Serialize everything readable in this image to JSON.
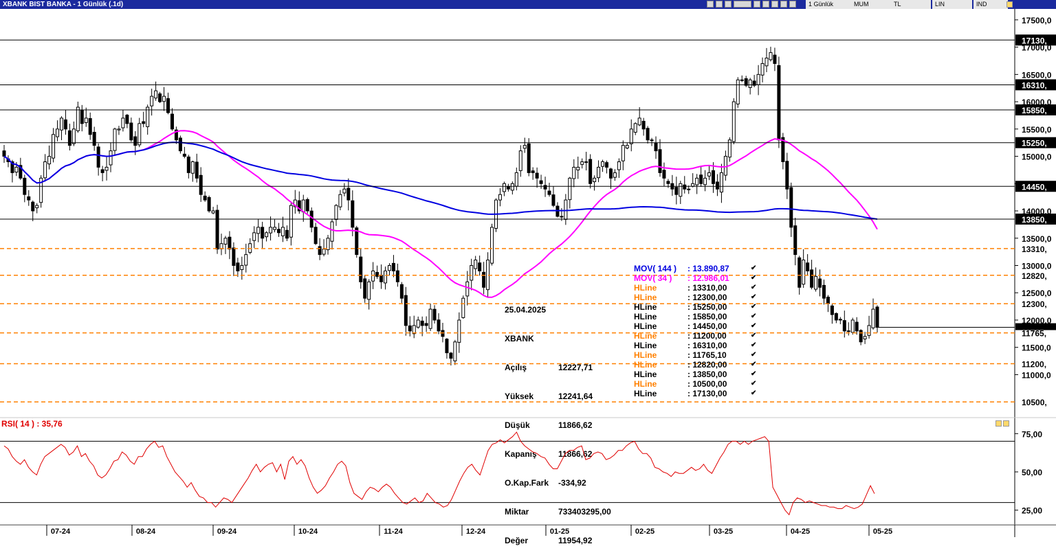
{
  "window": {
    "title": "XBANK BIST BANKA - 1 Günlük (.1d)",
    "toolbar": [
      "1 Günlük",
      "MUM",
      "TL",
      "LIN",
      "IND"
    ]
  },
  "colors": {
    "mov144": "#0000e0",
    "mov34": "#ff00ff",
    "hline_black": "#000000",
    "hline_orange": "#ff8000",
    "rsi": "#e00000",
    "titlebar": "#1b2a9e"
  },
  "info": {
    "date": "25.04.2025",
    "symbol": "XBANK",
    "rows": [
      {
        "k": "Açılış",
        "v": "12227,71"
      },
      {
        "k": "Yüksek",
        "v": "12241,64"
      },
      {
        "k": "Düşük",
        "v": "11866,62"
      },
      {
        "k": "Kapanış",
        "v": "11866,62"
      },
      {
        "k": "O.Kap.Fark",
        "v": "-334,92"
      },
      {
        "k": "Miktar",
        "v": "733403295,00"
      },
      {
        "k": "Değer",
        "v": "11954,92"
      }
    ]
  },
  "legend": [
    {
      "k": "MOV( 144 )",
      "v": ": 13.890,87",
      "color": "#0000e0"
    },
    {
      "k": "MOV( 34 )",
      "v": ": 12.986,01",
      "color": "#ff00ff"
    },
    {
      "k": "HLine",
      "v": ": 13310,00",
      "color": "#ff8000"
    },
    {
      "k": "HLine",
      "v": ": 12300,00",
      "color": "#ff8000"
    },
    {
      "k": "HLine",
      "v": ": 15250,00",
      "color": "#000000"
    },
    {
      "k": "HLine",
      "v": ": 15850,00",
      "color": "#000000"
    },
    {
      "k": "HLine",
      "v": ": 14450,00",
      "color": "#000000"
    },
    {
      "k": "HLine",
      "v": ": 11200,00",
      "color": "#ff8000"
    },
    {
      "k": "HLine",
      "v": ": 16310,00",
      "color": "#000000"
    },
    {
      "k": "HLine",
      "v": ": 11765,10",
      "color": "#ff8000"
    },
    {
      "k": "HLine",
      "v": ": 12820,00",
      "color": "#ff8000"
    },
    {
      "k": "HLine",
      "v": ": 13850,00",
      "color": "#000000"
    },
    {
      "k": "HLine",
      "v": ": 10500,00",
      "color": "#ff8000"
    },
    {
      "k": "HLine",
      "v": ": 17130,00",
      "color": "#000000"
    }
  ],
  "rsi_label": "RSI( 14 )   : 35,76",
  "chart_data": [
    {
      "type": "candlestick",
      "title": "XBANK BIST BANKA - 1 Günlük (.1d)",
      "ylim": [
        10200,
        17700
      ],
      "y_ticks": [
        17500,
        17000,
        16500,
        16000,
        15500,
        15000,
        14500,
        14000,
        13500,
        13000,
        12500,
        12000,
        11500,
        11000
      ],
      "y_tick_labels": [
        "17500,0",
        "17000,0",
        "16500,0",
        "16000,0",
        "15500,0",
        "15000,0",
        "14500,0",
        "14000,0",
        "13500,0",
        "13000,0",
        "12500,0",
        "12000,0",
        "11500,0",
        "11000,0"
      ],
      "x_tick_labels": [
        "07-24",
        "08-24",
        "09-24",
        "10-24",
        "11-24",
        "12-24",
        "01-25",
        "02-25",
        "03-25",
        "04-25",
        "05-25"
      ],
      "hlines": [
        {
          "value": 17130,
          "label": "17130,",
          "style": "solid",
          "color": "#000000"
        },
        {
          "value": 16310,
          "label": "16310,",
          "style": "solid",
          "color": "#000000"
        },
        {
          "value": 15850,
          "label": "15850,",
          "style": "solid",
          "color": "#000000"
        },
        {
          "value": 15250,
          "label": "15250,",
          "style": "solid",
          "color": "#000000"
        },
        {
          "value": 14450,
          "label": "14450,",
          "style": "solid",
          "color": "#000000"
        },
        {
          "value": 13850,
          "label": "13850,",
          "style": "solid",
          "color": "#000000"
        },
        {
          "value": 13310,
          "label": "13310,",
          "style": "dashed",
          "color": "#ff8000"
        },
        {
          "value": 12820,
          "label": "12820,",
          "style": "dashed",
          "color": "#ff8000"
        },
        {
          "value": 12300,
          "label": "12300,",
          "style": "dashed",
          "color": "#ff8000"
        },
        {
          "value": 11765,
          "label": "11765,",
          "style": "dashed",
          "color": "#ff8000"
        },
        {
          "value": 11200,
          "label": "11200,",
          "style": "dashed",
          "color": "#ff8000"
        },
        {
          "value": 10500,
          "label": "10500,",
          "style": "dashed",
          "color": "#ff8000"
        }
      ],
      "last_price": 11866.62,
      "close_series": [
        15000,
        14900,
        14700,
        14800,
        14600,
        14300,
        14200,
        14000,
        14100,
        14600,
        14900,
        15000,
        15400,
        15500,
        15700,
        15500,
        15200,
        15500,
        15900,
        15600,
        15700,
        15400,
        15200,
        14800,
        14700,
        14800,
        15100,
        15500,
        15500,
        15700,
        15600,
        15300,
        15200,
        15600,
        15600,
        15900,
        16100,
        16200,
        16000,
        16100,
        15800,
        15500,
        15300,
        15100,
        15000,
        14700,
        14900,
        14600,
        14300,
        14200,
        14000,
        14000,
        13300,
        13400,
        13500,
        13300,
        13000,
        12900,
        13000,
        13200,
        13400,
        13600,
        13700,
        13500,
        13600,
        13700,
        13700,
        13600,
        13700,
        13500,
        14100,
        14200,
        14000,
        14200,
        14000,
        13700,
        13400,
        13200,
        13300,
        13500,
        13800,
        14100,
        14300,
        14400,
        14200,
        13700,
        13200,
        12700,
        12400,
        12700,
        12900,
        12800,
        12700,
        12900,
        13000,
        12900,
        12700,
        12400,
        11900,
        11800,
        11900,
        12000,
        11900,
        11900,
        12200,
        12000,
        11800,
        11700,
        11400,
        11300,
        11600,
        12000,
        12400,
        12700,
        13000,
        13100,
        12900,
        12600,
        13100,
        13700,
        14200,
        14300,
        14500,
        14400,
        14500,
        14700,
        15100,
        15200,
        14700,
        14700,
        14600,
        14500,
        14400,
        14300,
        14100,
        13900,
        13900,
        14200,
        14600,
        14800,
        14800,
        14900,
        14900,
        14500,
        14600,
        14800,
        14900,
        14800,
        14600,
        14700,
        14900,
        15200,
        15200,
        15500,
        15600,
        15700,
        15500,
        15300,
        15300,
        15100,
        14700,
        14600,
        14500,
        14400,
        14300,
        14500,
        14400,
        14400,
        14500,
        14600,
        14500,
        14600,
        14700,
        14500,
        14400,
        14700,
        15000,
        15300,
        16000,
        16400,
        16400,
        16300,
        16400,
        16300,
        16500,
        16700,
        16800,
        16900,
        16700,
        15300,
        14900,
        14400,
        13700,
        13200,
        12600,
        13100,
        12900,
        12600,
        12800,
        12600,
        12400,
        12300,
        12100,
        12000,
        12000,
        11800,
        11800,
        12000,
        11800,
        11600,
        11700,
        11900,
        12200,
        11866.62
      ]
    },
    {
      "type": "line",
      "title": "RSI( 14 )",
      "ylim": [
        15,
        85
      ],
      "y_ticks": [
        75,
        50,
        25
      ],
      "y_tick_labels": [
        "75,00",
        "50,00",
        "25,00"
      ],
      "ref_lines": [
        70,
        30
      ],
      "series": [
        {
          "name": "RSI( 14 )",
          "last": 35.76,
          "values": [
            67,
            65,
            60,
            57,
            55,
            58,
            53,
            50,
            48,
            55,
            60,
            62,
            64,
            66,
            68,
            66,
            61,
            63,
            67,
            60,
            62,
            57,
            54,
            48,
            46,
            48,
            52,
            57,
            58,
            63,
            61,
            57,
            55,
            60,
            60,
            65,
            68,
            70,
            66,
            67,
            60,
            55,
            50,
            47,
            44,
            40,
            43,
            38,
            34,
            33,
            30,
            30,
            27,
            30,
            33,
            32,
            30,
            34,
            38,
            42,
            46,
            51,
            55,
            50,
            53,
            55,
            56,
            50,
            55,
            45,
            57,
            60,
            55,
            58,
            54,
            46,
            40,
            36,
            38,
            41,
            46,
            50,
            55,
            57,
            54,
            43,
            36,
            34,
            32,
            37,
            40,
            39,
            37,
            40,
            42,
            40,
            36,
            33,
            30,
            29,
            31,
            33,
            30,
            31,
            36,
            33,
            30,
            29,
            27,
            28,
            32,
            38,
            44,
            49,
            53,
            55,
            51,
            48,
            56,
            64,
            68,
            69,
            71,
            69,
            71,
            73,
            76,
            70,
            67,
            65,
            63,
            62,
            60,
            59,
            55,
            52,
            52,
            57,
            62,
            64,
            64,
            66,
            67,
            58,
            59,
            62,
            63,
            62,
            58,
            59,
            61,
            64,
            64,
            67,
            69,
            70,
            65,
            62,
            62,
            59,
            53,
            52,
            50,
            49,
            47,
            50,
            49,
            49,
            51,
            53,
            51,
            52,
            55,
            51,
            49,
            54,
            59,
            63,
            68,
            70,
            70,
            68,
            70,
            68,
            70,
            71,
            72,
            73,
            70,
            40,
            35,
            30,
            25,
            22,
            30,
            33,
            32,
            30,
            31,
            30,
            29,
            28,
            28,
            27,
            27,
            26,
            26,
            28,
            27,
            26,
            27,
            29,
            35,
            41,
            35.76
          ]
        }
      ]
    }
  ]
}
